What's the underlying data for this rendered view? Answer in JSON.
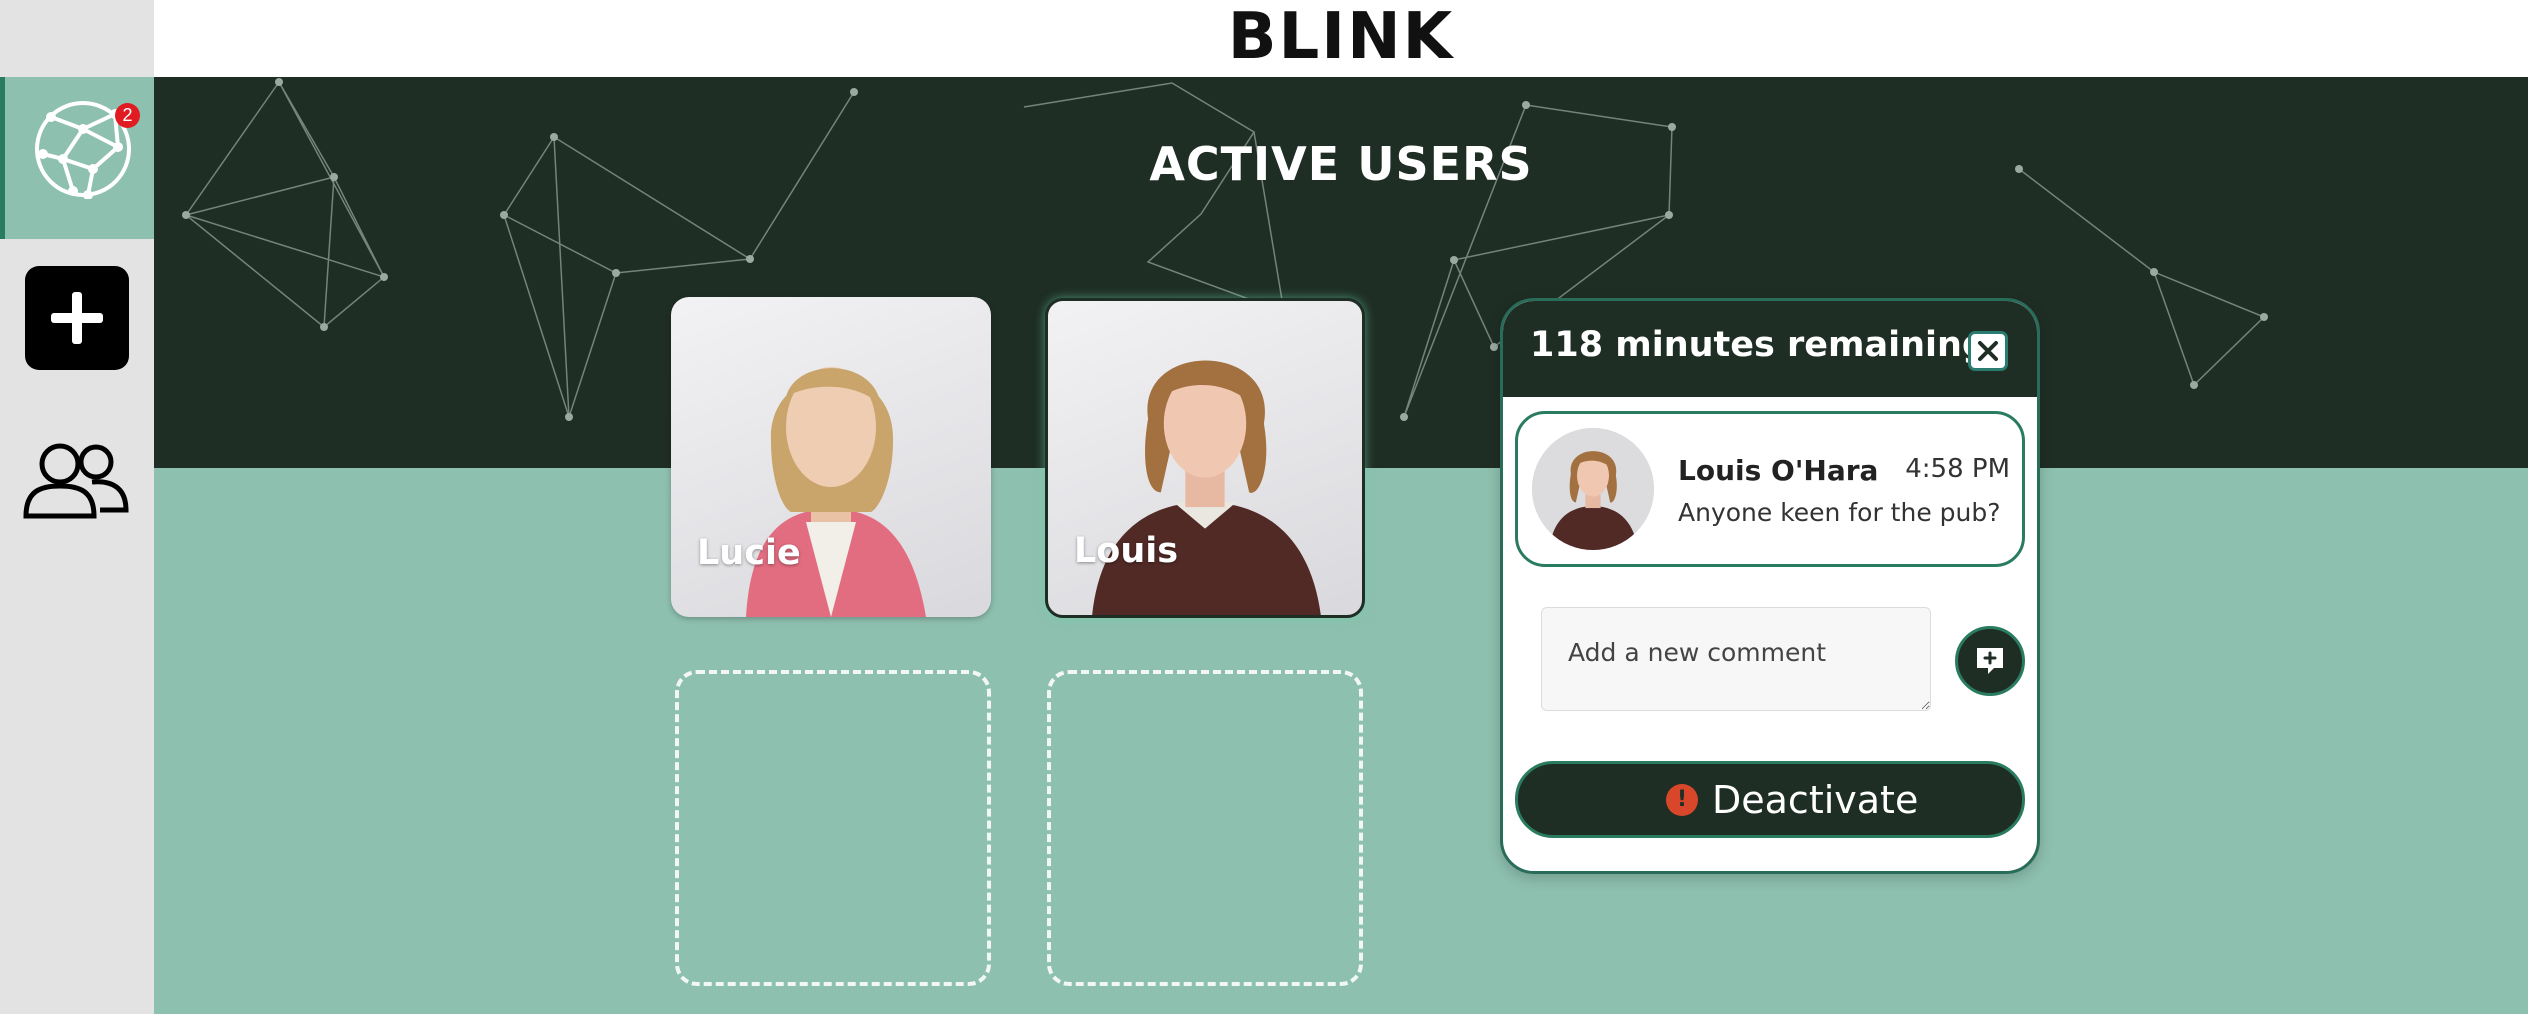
{
  "header": {
    "logo_text": "BLINK"
  },
  "sidebar": {
    "network_badge_count": "2",
    "items": [
      {
        "name": "network",
        "icon": "network-globe-icon"
      },
      {
        "name": "add",
        "icon": "plus-icon"
      },
      {
        "name": "users",
        "icon": "users-icon"
      }
    ]
  },
  "hero": {
    "title": "ACTIVE USERS"
  },
  "cards": [
    {
      "name": "Lucie"
    },
    {
      "name": "Louis"
    }
  ],
  "panel": {
    "title": "118 minutes remaining",
    "message": {
      "author": "Louis O'Hara",
      "time": "4:58 PM",
      "text": "Anyone keen for the pub?"
    },
    "comment_placeholder": "Add a new comment",
    "deactivate_label": "Deactivate",
    "deactivate_icon_glyph": "!"
  },
  "colors": {
    "accent_green": "#2a7c61",
    "dark_green": "#1f2e25",
    "mint": "#8ec0af",
    "badge_red": "#e01b22",
    "warning": "#d9472b"
  }
}
